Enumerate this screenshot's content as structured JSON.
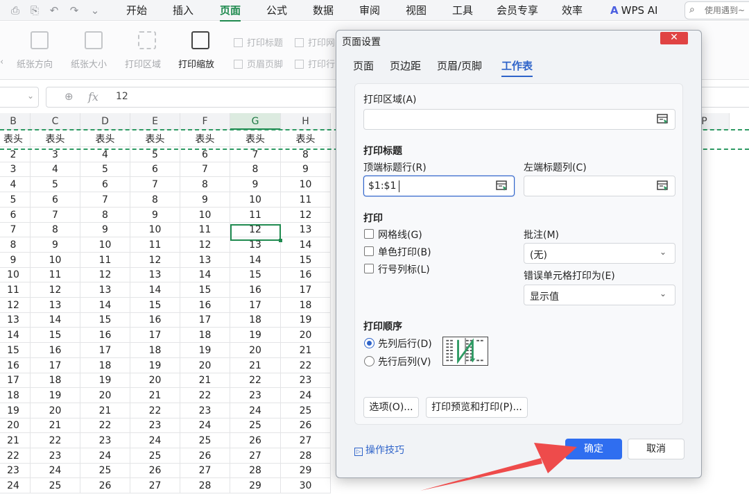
{
  "menubar": {
    "quick_icons": [
      "print-icon",
      "print-preview-icon",
      "undo-icon",
      "redo-icon",
      "chevron-down-icon"
    ],
    "tabs": [
      "开始",
      "插入",
      "页面",
      "公式",
      "数据",
      "审阅",
      "视图",
      "工具",
      "会员专享",
      "效率"
    ],
    "active_tab": "页面",
    "wps_ai": "WPS AI",
    "search_placeholder": "使用遇到~"
  },
  "ribbon": {
    "buttons": [
      {
        "label": "纸张方向",
        "icon": "orientation-icon"
      },
      {
        "label": "纸张大小",
        "icon": "paper-size-icon"
      },
      {
        "label": "打印区域",
        "icon": "print-area-icon"
      },
      {
        "label": "打印缩放",
        "icon": "print-scale-icon"
      }
    ],
    "small_items": [
      "打印标题",
      "页眉页脚",
      "打印网",
      "打印行"
    ],
    "left_arrow": "‹"
  },
  "formula_bar": {
    "fx_label": "fx",
    "value": "12"
  },
  "sheet": {
    "columns": [
      "B",
      "C",
      "D",
      "E",
      "F",
      "G",
      "H",
      "P"
    ],
    "selected_column": "G",
    "header_row": [
      "表头",
      "表头",
      "表头",
      "表头",
      "表头",
      "表头",
      "表头"
    ],
    "rows": [
      [
        "2",
        "3",
        "4",
        "5",
        "6",
        "7",
        "8"
      ],
      [
        "3",
        "4",
        "5",
        "6",
        "7",
        "8",
        "9"
      ],
      [
        "4",
        "5",
        "6",
        "7",
        "8",
        "9",
        "10"
      ],
      [
        "5",
        "6",
        "7",
        "8",
        "9",
        "10",
        "11"
      ],
      [
        "6",
        "7",
        "8",
        "9",
        "10",
        "11",
        "12"
      ],
      [
        "7",
        "8",
        "9",
        "10",
        "11",
        "12",
        "13"
      ],
      [
        "8",
        "9",
        "10",
        "11",
        "12",
        "13",
        "14"
      ],
      [
        "9",
        "10",
        "11",
        "12",
        "13",
        "14",
        "15"
      ],
      [
        "10",
        "11",
        "12",
        "13",
        "14",
        "15",
        "16"
      ],
      [
        "11",
        "12",
        "13",
        "14",
        "15",
        "16",
        "17"
      ],
      [
        "12",
        "13",
        "14",
        "15",
        "16",
        "17",
        "18"
      ],
      [
        "13",
        "14",
        "15",
        "16",
        "17",
        "18",
        "19"
      ],
      [
        "14",
        "15",
        "16",
        "17",
        "18",
        "19",
        "20"
      ],
      [
        "15",
        "16",
        "17",
        "18",
        "19",
        "20",
        "21"
      ],
      [
        "16",
        "17",
        "18",
        "19",
        "20",
        "21",
        "22"
      ],
      [
        "17",
        "18",
        "19",
        "20",
        "21",
        "22",
        "23"
      ],
      [
        "18",
        "19",
        "20",
        "21",
        "22",
        "23",
        "24"
      ],
      [
        "19",
        "20",
        "21",
        "22",
        "23",
        "24",
        "25"
      ],
      [
        "20",
        "21",
        "22",
        "23",
        "24",
        "25",
        "26"
      ],
      [
        "21",
        "22",
        "23",
        "24",
        "25",
        "26",
        "27"
      ],
      [
        "22",
        "23",
        "24",
        "25",
        "26",
        "27",
        "28"
      ],
      [
        "23",
        "24",
        "25",
        "26",
        "27",
        "28",
        "29"
      ],
      [
        "24",
        "25",
        "26",
        "27",
        "28",
        "29",
        "30"
      ]
    ],
    "active_cell_value": "12",
    "print_border_color": "#2e9a63"
  },
  "dialog": {
    "title": "页面设置",
    "close_symbol": "✕",
    "tabs": [
      "页面",
      "页边距",
      "页眉/页脚",
      "工作表"
    ],
    "active_tab": "工作表",
    "print_area": {
      "label": "打印区域(A)",
      "value": ""
    },
    "print_titles": {
      "heading": "打印标题",
      "top_rows_label": "顶端标题行(R)",
      "top_rows_value": "$1:$1",
      "left_cols_label": "左端标题列(C)",
      "left_cols_value": ""
    },
    "print": {
      "heading": "打印",
      "gridlines": "网格线(G)",
      "mono": "单色打印(B)",
      "row_col_headers": "行号列标(L)",
      "comments_label": "批注(M)",
      "comments_value": "(无)",
      "errors_label": "错误单元格打印为(E)",
      "errors_value": "显示值"
    },
    "order": {
      "heading": "打印顺序",
      "down_then_over": "先列后行(D)",
      "over_then_down": "先行后列(V)",
      "selected": "先列后行(D)"
    },
    "options_button": "选项(O)...",
    "preview_button": "打印预览和打印(P)...",
    "tips_link": "操作技巧",
    "ok_button": "确定",
    "cancel_button": "取消",
    "accent_color": "#2f6ef0"
  },
  "annotation": {
    "arrow_color": "#ee4b4b"
  }
}
